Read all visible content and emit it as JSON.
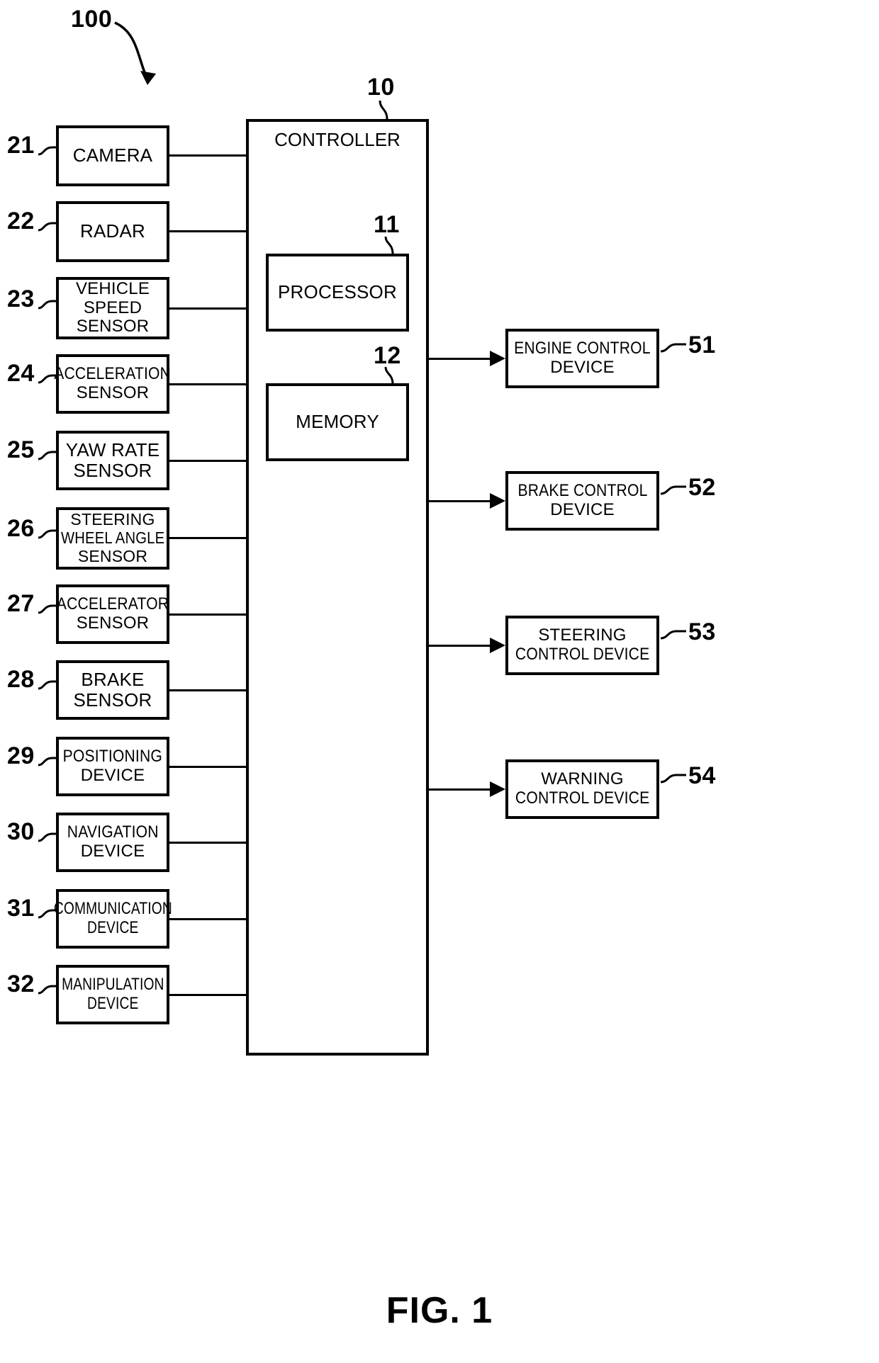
{
  "figure": {
    "caption": "FIG. 1",
    "system_ref": "100"
  },
  "controller": {
    "title": "CONTROLLER",
    "ref": "10",
    "components": [
      {
        "label": "PROCESSOR",
        "ref": "11"
      },
      {
        "label": "MEMORY",
        "ref": "12"
      }
    ]
  },
  "inputs": [
    {
      "ref": "21",
      "lines": [
        "CAMERA"
      ]
    },
    {
      "ref": "22",
      "lines": [
        "RADAR"
      ]
    },
    {
      "ref": "23",
      "lines": [
        "VEHICLE",
        "SPEED",
        "SENSOR"
      ]
    },
    {
      "ref": "24",
      "lines": [
        "ACCELERATION",
        "SENSOR"
      ]
    },
    {
      "ref": "25",
      "lines": [
        "YAW RATE",
        "SENSOR"
      ]
    },
    {
      "ref": "26",
      "lines": [
        "STEERING",
        "WHEEL ANGLE",
        "SENSOR"
      ]
    },
    {
      "ref": "27",
      "lines": [
        "ACCELERATOR",
        "SENSOR"
      ]
    },
    {
      "ref": "28",
      "lines": [
        "BRAKE",
        "SENSOR"
      ]
    },
    {
      "ref": "29",
      "lines": [
        "POSITIONING",
        "DEVICE"
      ]
    },
    {
      "ref": "30",
      "lines": [
        "NAVIGATION",
        "DEVICE"
      ]
    },
    {
      "ref": "31",
      "lines": [
        "COMMUNICATION",
        "DEVICE"
      ]
    },
    {
      "ref": "32",
      "lines": [
        "MANIPULATION",
        "DEVICE"
      ]
    }
  ],
  "outputs": [
    {
      "ref": "51",
      "lines": [
        "ENGINE CONTROL",
        "DEVICE"
      ]
    },
    {
      "ref": "52",
      "lines": [
        "BRAKE CONTROL",
        "DEVICE"
      ]
    },
    {
      "ref": "53",
      "lines": [
        "STEERING",
        "CONTROL DEVICE"
      ]
    },
    {
      "ref": "54",
      "lines": [
        "WARNING",
        "CONTROL DEVICE"
      ]
    }
  ],
  "colors": {
    "stroke": "#000000",
    "background": "#ffffff"
  }
}
